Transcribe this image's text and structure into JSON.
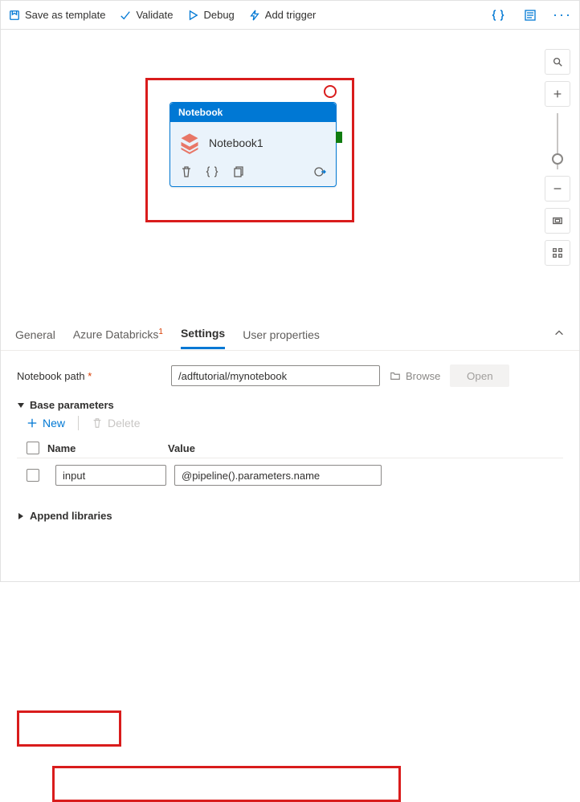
{
  "toolbar": {
    "save_template": "Save as template",
    "validate": "Validate",
    "debug": "Debug",
    "add_trigger": "Add trigger"
  },
  "canvas": {
    "node": {
      "type_label": "Notebook",
      "title": "Notebook1"
    }
  },
  "panel": {
    "tabs": {
      "general": "General",
      "databricks": "Azure Databricks",
      "settings": "Settings",
      "user_props": "User properties"
    },
    "notebook_path_label": "Notebook path",
    "notebook_path_value": "/adftutorial/mynotebook",
    "browse": "Browse",
    "open": "Open",
    "base_params_label": "Base parameters",
    "new_btn": "New",
    "delete_btn": "Delete",
    "grid": {
      "header_name": "Name",
      "header_value": "Value",
      "rows": [
        {
          "name": "input",
          "value": "@pipeline().parameters.name"
        }
      ]
    },
    "append_libs": "Append libraries"
  }
}
